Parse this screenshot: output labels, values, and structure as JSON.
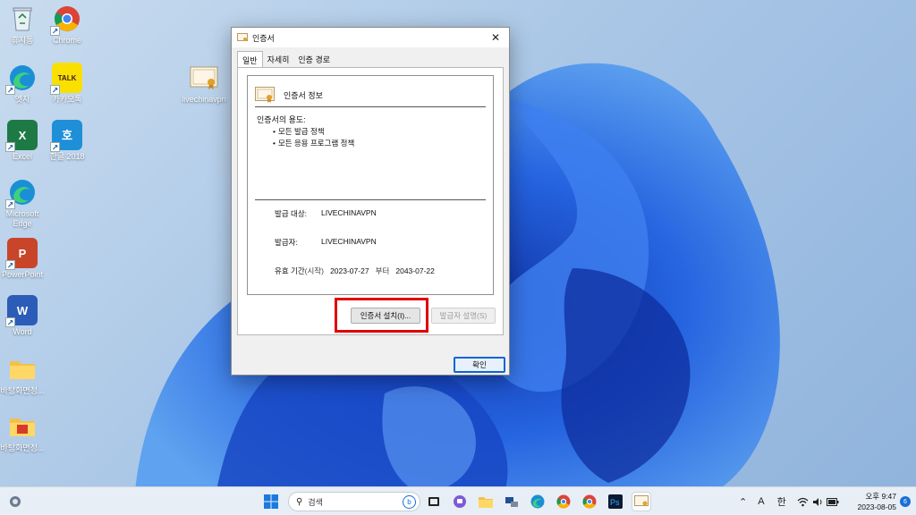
{
  "desktop": {
    "icons": [
      {
        "label": "휴지통",
        "icon": "recycle-bin-icon"
      },
      {
        "label": "Chrome",
        "icon": "chrome-icon"
      },
      {
        "label": "엣지",
        "icon": "edge-icon"
      },
      {
        "label": "카카오톡",
        "icon": "kakaotalk-icon",
        "glyph": "TALK"
      },
      {
        "label": "livechinavpn",
        "icon": "certificate-file-icon"
      },
      {
        "label": "Excel",
        "icon": "excel-icon",
        "glyph": "X"
      },
      {
        "label": "한글 2018",
        "icon": "hangul-icon",
        "glyph": "호"
      },
      {
        "label": "Microsoft Edge",
        "icon": "edge-icon"
      },
      {
        "label": "PowerPoint",
        "icon": "powerpoint-icon",
        "glyph": "P"
      },
      {
        "label": "Word",
        "icon": "word-icon",
        "glyph": "W"
      },
      {
        "label": "바탕화면정...",
        "icon": "folder-icon"
      },
      {
        "label": "바탕화면정...",
        "icon": "folder-red-icon"
      }
    ]
  },
  "dialog": {
    "title": "인증서",
    "tabs": [
      {
        "label": "일반",
        "active": true
      },
      {
        "label": "자세히",
        "active": false
      },
      {
        "label": "인증 경로",
        "active": false
      }
    ],
    "header": "인증서 정보",
    "purpose_label": "인증서의 용도:",
    "purposes": [
      "모든 발급 정책",
      "모든 응용 프로그램 정책"
    ],
    "issued_to_label": "발급 대상:",
    "issued_to": "LIVECHINAVPN",
    "issued_by_label": "발급자:",
    "issued_by": "LIVECHINAVPN",
    "validity_label": "유효 기간",
    "validity_from_label": "(시작)",
    "valid_from": "2023-07-27",
    "validity_to_label": "부터",
    "valid_to": "2043-07-22",
    "install_button": "인증서 설치(I)...",
    "issuer_statement_button": "발급자 설명(S)",
    "ok_button": "확인"
  },
  "taskbar": {
    "search_placeholder": "검색",
    "tray": {
      "ime_mode": "A",
      "ime_lang": "한"
    },
    "clock_time": "오후 9:47",
    "clock_date": "2023-08-05",
    "notification_count": "6"
  },
  "colors": {
    "highlight": "#e00000",
    "accent": "#0a64d6"
  }
}
